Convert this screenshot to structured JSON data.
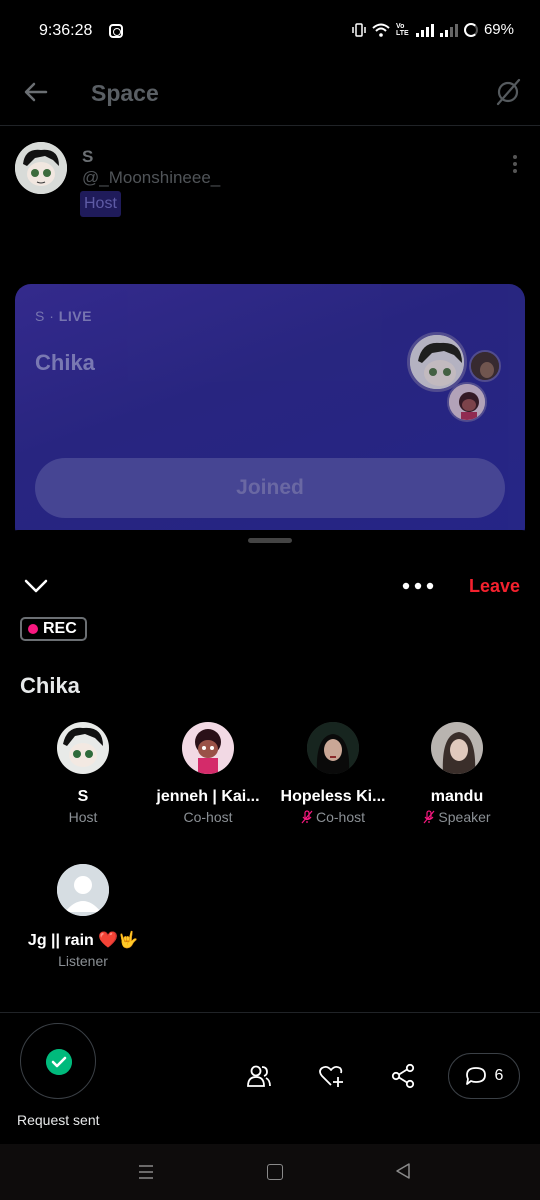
{
  "status_bar": {
    "time": "9:36:28",
    "battery": "69%",
    "network_label": "Vo LTE"
  },
  "header": {
    "title": "Space"
  },
  "host": {
    "name": "S",
    "handle": "@_Moonshineee_",
    "badge": "Host"
  },
  "space_card": {
    "host_initial": "S",
    "live_label": "LIVE",
    "title": "Chika",
    "joined_label": "Joined"
  },
  "sheet": {
    "leave_label": "Leave",
    "rec_label": "REC",
    "title": "Chika",
    "participants": [
      {
        "name": "S",
        "role": "Host",
        "muted": false
      },
      {
        "name": "jenneh | Kai...",
        "role": "Co-host",
        "muted": false
      },
      {
        "name": "Hopeless Ki...",
        "role": "Co-host",
        "muted": true
      },
      {
        "name": "mandu",
        "role": "Speaker",
        "muted": true
      },
      {
        "name": "Jg || rain ❤️🤟",
        "role": "Listener",
        "muted": false
      }
    ]
  },
  "actions": {
    "request_label": "Request sent",
    "comments_count": "6"
  },
  "colors": {
    "accent_red": "#f4212e",
    "rec_dot": "#f91880",
    "success_green": "#00ba7c",
    "card_purple": "#3a2f9c"
  },
  "icons": [
    "back-icon",
    "spaces-off-icon",
    "more-vert-icon",
    "chevron-down-icon",
    "more-horiz-icon",
    "mic-off-icon",
    "check-icon",
    "people-icon",
    "heart-plus-icon",
    "share-icon",
    "comment-icon"
  ]
}
